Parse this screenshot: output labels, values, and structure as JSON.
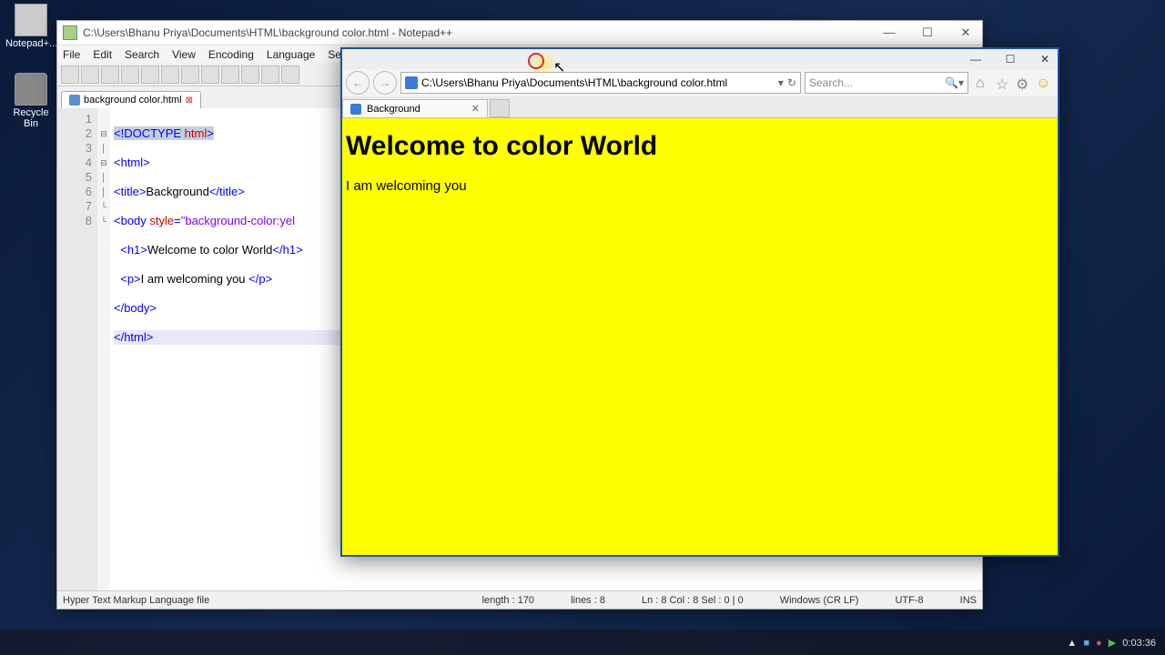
{
  "desktop": {
    "icons": [
      {
        "label": "Notepad+..."
      },
      {
        "label": "Recycle Bin"
      }
    ]
  },
  "npp": {
    "title": "C:\\Users\\Bhanu Priya\\Documents\\HTML\\background color.html - Notepad++",
    "menu": [
      "File",
      "Edit",
      "Search",
      "View",
      "Encoding",
      "Language",
      "Setting"
    ],
    "tab_label": "background color.html",
    "code": {
      "l1_a": "<!DOCTYPE ",
      "l1_b": "html",
      "l1_c": ">",
      "l2": "<html>",
      "l3_a": "<title>",
      "l3_b": "Background",
      "l3_c": "</title>",
      "l4_a": "<body ",
      "l4_b": "style",
      "l4_c": "=",
      "l4_d": "\"background-color:yel",
      "l5_a": "<h1>",
      "l5_b": "Welcome to color World",
      "l5_c": "</h1>",
      "l6_a": "<p>",
      "l6_b": "I am welcoming you ",
      "l6_c": "</p>",
      "l7": "</body>",
      "l8": "</html>"
    },
    "line_nums": [
      "1",
      "2",
      "3",
      "4",
      "5",
      "6",
      "7",
      "8"
    ],
    "status": {
      "type": "Hyper Text Markup Language file",
      "length": "length : 170",
      "lines": "lines : 8",
      "pos": "Ln : 8   Col : 8   Sel : 0 | 0",
      "eol": "Windows (CR LF)",
      "enc": "UTF-8",
      "ins": "INS"
    }
  },
  "ie": {
    "url": "C:\\Users\\Bhanu Priya\\Documents\\HTML\\background color.html",
    "search_placeholder": "Search...",
    "tab_label": "Background",
    "page": {
      "heading": "Welcome to color World",
      "paragraph": "I am welcoming you"
    }
  },
  "taskbar": {
    "time": "0:03:36",
    "date": ""
  }
}
